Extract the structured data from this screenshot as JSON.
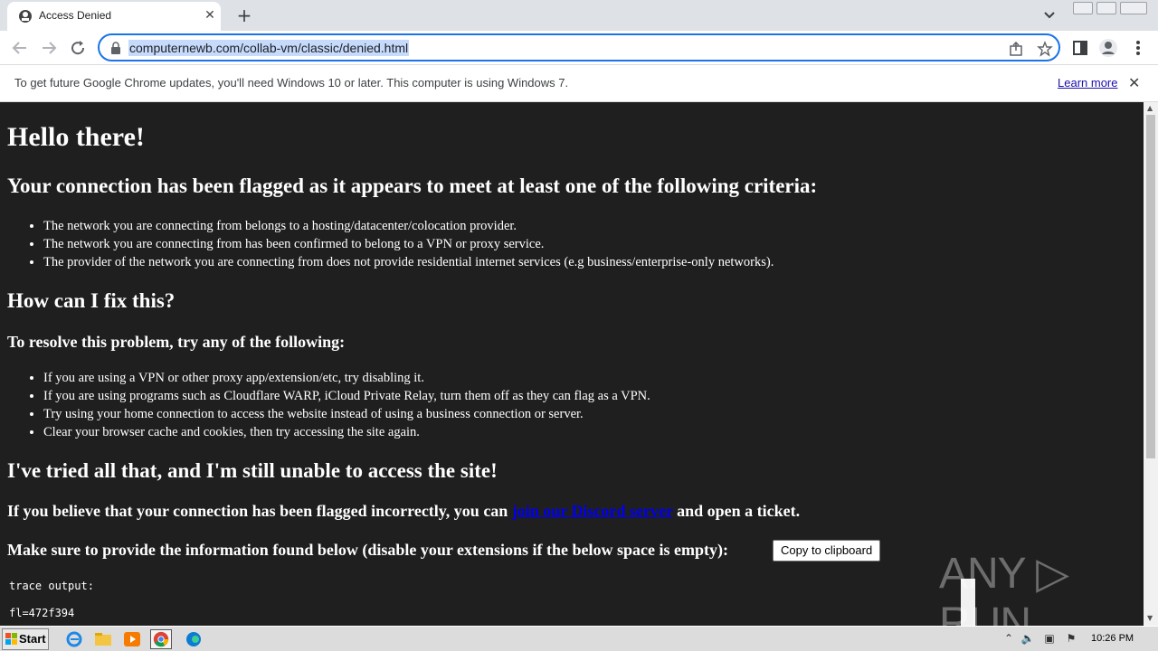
{
  "browser": {
    "tab_title": "Access Denied",
    "tab_close": "✕",
    "new_tab": "+",
    "url": "computernewb.com/collab-vm/classic/denied.html"
  },
  "infobar": {
    "message": "To get future Google Chrome updates, you'll need Windows 10 or later. This computer is using Windows 7.",
    "learn_more": "Learn more",
    "close": "✕"
  },
  "page": {
    "heading": "Hello there!",
    "flag_heading": "Your connection has been flagged as it appears to meet at least one of the following criteria:",
    "criteria": [
      "The network you are connecting from belongs to a hosting/datacenter/colocation provider.",
      "The network you are connecting from has been confirmed to belong to a VPN or proxy service.",
      "The provider of the network you are connecting from does not provide residential internet services (e.g business/enterprise-only networks)."
    ],
    "fix_heading": "How can I fix this?",
    "resolve_heading": "To resolve this problem, try any of the following:",
    "fixes": [
      "If you are using a VPN or other proxy app/extension/etc, try disabling it.",
      "If you are using programs such as Cloudflare WARP, iCloud Private Relay, turn them off as they can flag as a VPN.",
      "Try using your home connection to access the website instead of using a business connection or server.",
      "Clear your browser cache and cookies, then try accessing the site again."
    ],
    "still_heading": "I've tried all that, and I'm still unable to access the site!",
    "believe_prefix": "If you believe that your connection has been flagged incorrectly, you can ",
    "discord_link": "join our Discord server",
    "believe_suffix": " and open a ticket.",
    "provide_text": "Make sure to provide the information found below (disable your extensions if the below space is empty):",
    "copy_button": "Copy to clipboard",
    "trace_label": "trace output:",
    "trace_line": "fl=472f394"
  },
  "watermark": "ANY ▷ RUN",
  "taskbar": {
    "start_label": "Start",
    "clock": "10:26 PM"
  },
  "colors": {
    "page_bg": "#1f1f1f",
    "link": "#0000ee",
    "omnibox_focus": "#1a73e8"
  }
}
